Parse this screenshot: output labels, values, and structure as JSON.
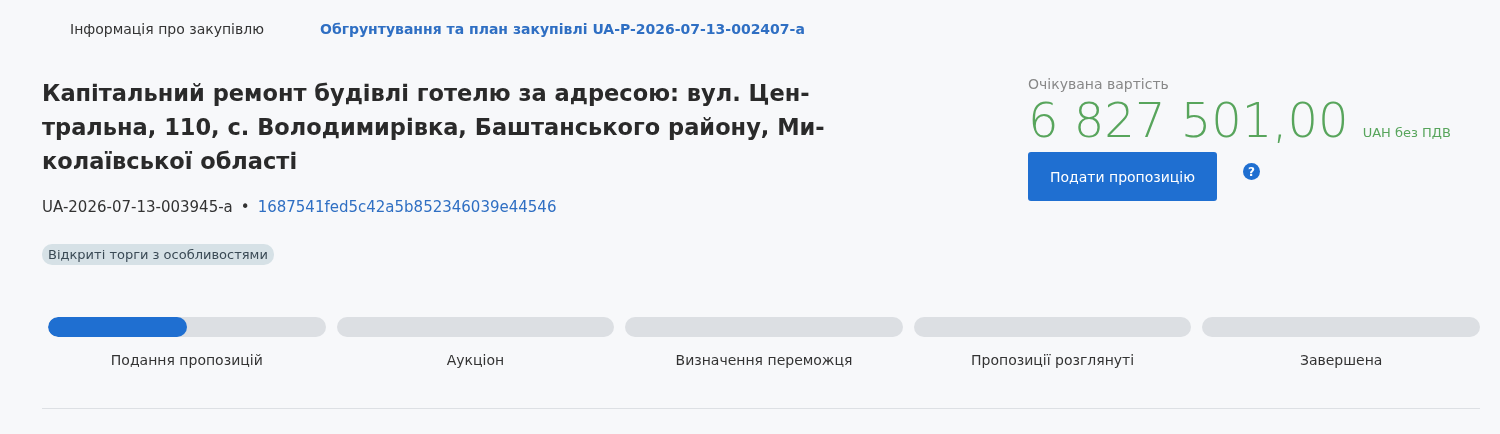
{
  "nav": [
    {
      "label": "Інформація про закупівлю",
      "kind": "text"
    },
    {
      "label": "Обгрунтування та план закупівлі UA-P-2026-07-13-002407-a",
      "kind": "link"
    }
  ],
  "title_lines": [
    "Капітальний ремонт будівлі готелю за адресою: вул. Цен-",
    "тральна, 110, с. Володимирівка, Баштанського району, Ми-",
    "колаївської області"
  ],
  "tender_id": "UA-2026-07-13-003945-a",
  "separator": "•",
  "hash": "1687541fed5c42a5b852346039e44546",
  "procedure_tag": "Відкриті торги з особливостями",
  "expected_value": {
    "label": "Очікувана вартість",
    "amount": "6 827 501,00",
    "currency": "UAH без ПДВ"
  },
  "submit_button": "Подати пропозицію",
  "help_icon": "?",
  "stages": [
    {
      "label": "Подання пропозицій",
      "level": 0.5
    },
    {
      "label": "Аукціон"
    },
    {
      "label": "Визначення переможця"
    },
    {
      "label": "Пропозиції розглянуті"
    },
    {
      "label": "Завершена"
    }
  ]
}
